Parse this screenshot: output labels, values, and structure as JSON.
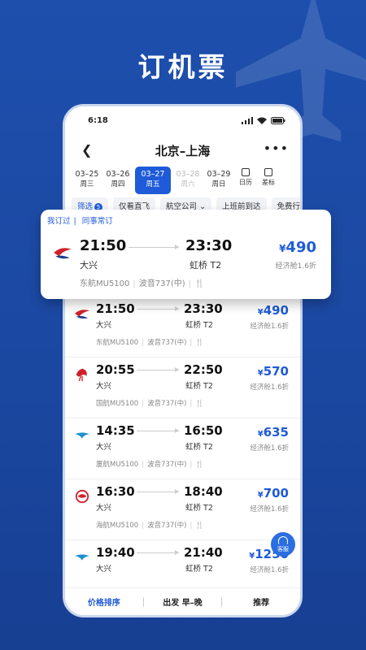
{
  "promo": {
    "title": "订机票"
  },
  "status_bar": {
    "time": "6:18"
  },
  "header": {
    "back_icon": "chevron-left-icon",
    "route": "北京–上海",
    "more_icon": "more-dots-icon"
  },
  "dates": [
    {
      "date": "03–25",
      "weekday": "周三"
    },
    {
      "date": "03–26",
      "weekday": "周四"
    },
    {
      "date": "03–27",
      "weekday": "周五",
      "selected": true
    },
    {
      "date": "03–28",
      "weekday": "周六",
      "dim": true
    },
    {
      "date": "03–29",
      "weekday": "周日"
    }
  ],
  "date_tools": [
    {
      "label": "日历",
      "icon": "calendar-icon"
    },
    {
      "label": "差标",
      "icon": "policy-icon"
    }
  ],
  "filters": {
    "filter_label": "筛选",
    "filter_count": "5",
    "items": [
      "仅看直飞",
      "航空公司",
      "上班前到达",
      "免费行李"
    ]
  },
  "highlight_card": {
    "tags": [
      "我订过",
      "同事常订"
    ],
    "dep_time": "21:50",
    "arr_time": "23:30",
    "dep_airport": "大兴",
    "arr_airport": "虹桥 T2",
    "flight": "东航MU5100",
    "aircraft": "波音737(中)",
    "price": "490",
    "currency": "¥",
    "cabin": "经济舱1.6折",
    "airline": "china-eastern"
  },
  "flights": [
    {
      "dep_time": "21:50",
      "arr_time": "23:30",
      "dep_airport": "大兴",
      "arr_airport": "虹桥 T2",
      "flight": "东航MU5100",
      "aircraft": "波音737(中)",
      "price": "490",
      "cabin": "经济舱1.6折",
      "airline": "china-eastern"
    },
    {
      "dep_time": "20:55",
      "arr_time": "22:50",
      "dep_airport": "大兴",
      "arr_airport": "虹桥 T2",
      "flight": "国航MU5100",
      "aircraft": "波音737(中)",
      "price": "570",
      "cabin": "经济舱1.6折",
      "airline": "air-china"
    },
    {
      "dep_time": "14:35",
      "arr_time": "16:50",
      "dep_airport": "大兴",
      "arr_airport": "虹桥 T2",
      "flight": "厦航MU5100",
      "aircraft": "波音737(中)",
      "price": "635",
      "cabin": "经济舱1.6折",
      "airline": "xiamen-air"
    },
    {
      "dep_time": "16:30",
      "arr_time": "18:40",
      "dep_airport": "大兴",
      "arr_airport": "虹桥 T2",
      "flight": "海航MU5100",
      "aircraft": "波音737(中)",
      "price": "700",
      "cabin": "经济舱1.6折",
      "airline": "hainan-air"
    },
    {
      "dep_time": "19:40",
      "arr_time": "21:40",
      "dep_airport": "大兴",
      "arr_airport": "虹桥 T2",
      "flight": "",
      "aircraft": "",
      "price": "1250",
      "cabin": "经济舱1.6折",
      "airline": "xiamen-air"
    }
  ],
  "service": {
    "label": "客服"
  },
  "bottom_bar": {
    "sort_price": "价格排序",
    "sort_departure": "出发 早–晚",
    "recommend": "推荐"
  },
  "colors": {
    "accent": "#1f5bd8",
    "background": "#1d4ea8"
  }
}
